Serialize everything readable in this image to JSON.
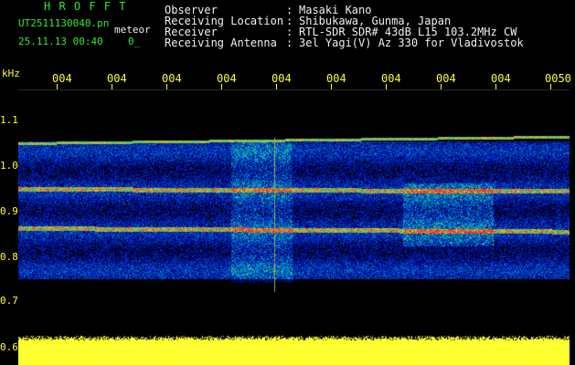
{
  "header": {
    "brand": "H R O F F T",
    "filename": "UT2511130040.pn",
    "mode": "meteor",
    "datetime": "25.11.13 00:40",
    "counter": "0_",
    "fields": [
      {
        "label": "Observer",
        "sep": ":",
        "value": "Masaki Kano"
      },
      {
        "label": "Receiving Location",
        "sep": ":",
        "value": "Shibukawa, Gunma, Japan"
      },
      {
        "label": "Receiver",
        "sep": ":",
        "value": "RTL-SDR SDR# 43dB L15 103.2MHz CW"
      },
      {
        "label": "Receiving Antenna",
        "sep": ":",
        "value": "3el Yagi(V) Az 330 for Vladivostok"
      }
    ]
  },
  "axis": {
    "y_unit": "kHz",
    "y_ticks": [
      "1.1",
      "1.0",
      "0.9",
      "0.8",
      "0.7",
      "0.6"
    ],
    "x_ticks": [
      "004",
      "004",
      "004",
      "004",
      "004",
      "004",
      "004",
      "004",
      "004",
      "0050"
    ]
  },
  "colors": {
    "header_green": "#33e833",
    "header_white": "#f0f0f0",
    "tick_yellow": "#ffff33",
    "background": "#000000",
    "signal_low": "#0a2a8a",
    "signal_mid": "#1aa0c0",
    "signal_high": "#e03030",
    "noise_floor_strip": "#ffff33"
  }
}
